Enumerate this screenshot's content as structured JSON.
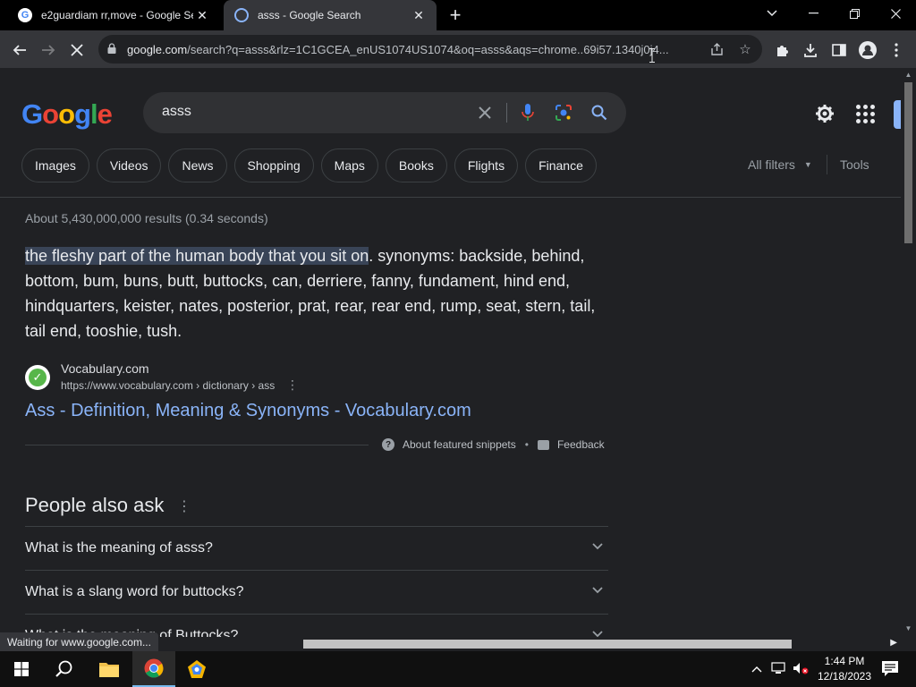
{
  "browser": {
    "tabs": [
      {
        "title": "e2guardiam rr,move - Google Se",
        "favicon": "G"
      },
      {
        "title": "asss - Google Search",
        "favicon": ""
      }
    ],
    "url_host": "google.com",
    "url_path": "/search?q=asss&rlz=1C1GCEA_enUS1074US1074&oq=asss&aqs=chrome..69i57.1340j0j4...",
    "status_text": "Waiting for www.google.com..."
  },
  "google": {
    "logo_letters": [
      "G",
      "o",
      "o",
      "g",
      "l",
      "e"
    ],
    "query": "asss",
    "chips": [
      "Images",
      "Videos",
      "News",
      "Shopping",
      "Maps",
      "Books",
      "Flights",
      "Finance"
    ],
    "all_filters": "All filters",
    "tools": "Tools",
    "result_stats": "About 5,430,000,000 results (0.34 seconds)",
    "snippet_highlight": "the fleshy part of the human body that you sit on",
    "snippet_rest": ". synonyms: backside, behind, bottom, bum, buns, butt, buttocks, can, derriere, fanny, fundament, hind end, hindquarters, keister, nates, posterior, prat, rear, rear end, rump, seat, stern, tail, tail end, tooshie, tush.",
    "source_name": "Vocabulary.com",
    "source_url": "https://www.vocabulary.com › dictionary › ass",
    "result_link": "Ass - Definition, Meaning & Synonyms - Vocabulary.com",
    "about_snippets": "About featured snippets",
    "feedback": "Feedback",
    "paa_title": "People also ask",
    "paa_questions": [
      "What is the meaning of asss?",
      "What is a slang word for buttocks?",
      "What is the meaning of Buttocks?"
    ]
  },
  "taskbar": {
    "time": "1:44 PM",
    "date": "12/18/2023"
  },
  "colors": {
    "page_bg": "#202124",
    "link": "#8ab4f8",
    "highlight": "#394457"
  }
}
